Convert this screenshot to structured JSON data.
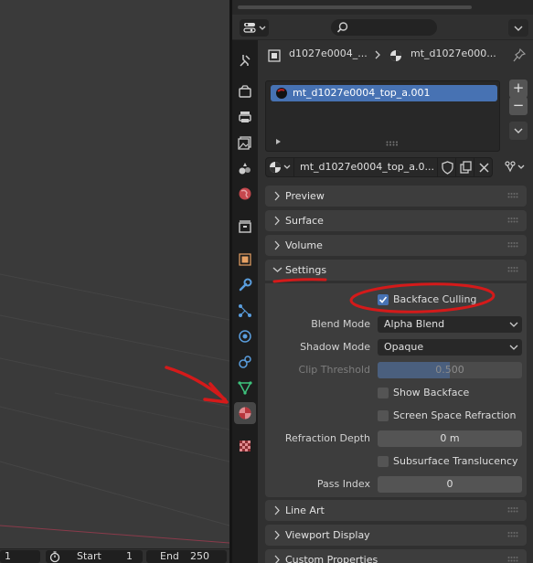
{
  "viewport": {
    "bottom": {
      "frame_current": "1",
      "start_label": "Start",
      "start_value": "1",
      "end_label": "End",
      "end_value": "250"
    }
  },
  "properties": {
    "search": {
      "placeholder": ""
    },
    "breadcrumb": {
      "object": "d1027e0004_...",
      "material": "mt_d1027e000..."
    },
    "material_slots": [
      {
        "name": "mt_d1027e0004_top_a.001",
        "selected": true
      }
    ],
    "material_selector": {
      "name": "mt_d1027e0004_top_a.0..."
    },
    "panels": {
      "preview": "Preview",
      "surface": "Surface",
      "volume": "Volume",
      "settings": "Settings",
      "line_art": "Line Art",
      "viewport_display": "Viewport Display",
      "custom_properties": "Custom Properties"
    },
    "settings": {
      "backface_culling": {
        "label": "Backface Culling",
        "checked": true
      },
      "blend_mode": {
        "label": "Blend Mode",
        "value": "Alpha Blend"
      },
      "shadow_mode": {
        "label": "Shadow Mode",
        "value": "Opaque"
      },
      "clip_threshold": {
        "label": "Clip Threshold",
        "value": "0.500",
        "fraction": 0.5
      },
      "show_backface": {
        "label": "Show Backface",
        "checked": false
      },
      "screen_space_refraction": {
        "label": "Screen Space Refraction",
        "checked": false
      },
      "refraction_depth": {
        "label": "Refraction Depth",
        "value": "0 m"
      },
      "subsurface_translucency": {
        "label": "Subsurface Translucency",
        "checked": false
      },
      "pass_index": {
        "label": "Pass Index",
        "value": "0"
      }
    }
  },
  "colors": {
    "accent": "#4772b3",
    "annotation": "#d41a1a"
  }
}
